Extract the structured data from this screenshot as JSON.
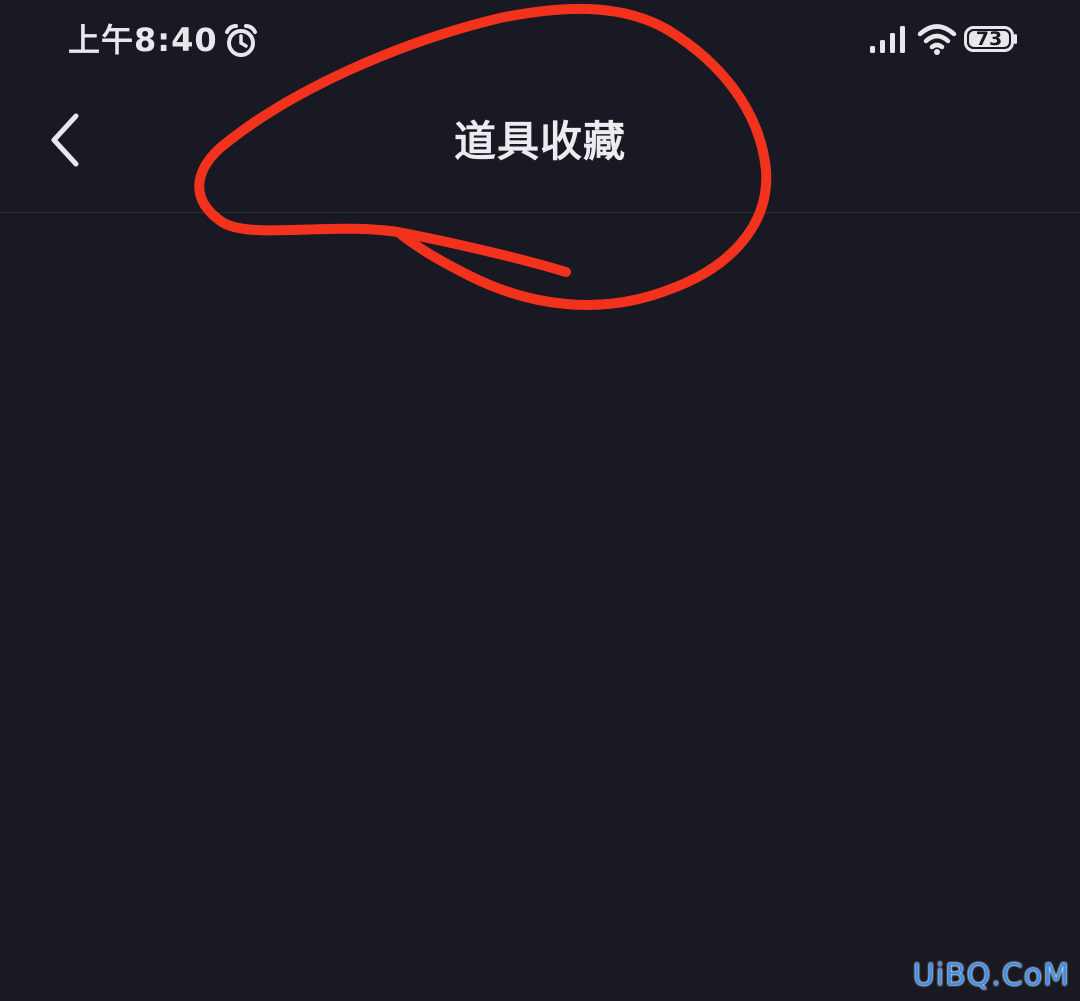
{
  "status_bar": {
    "time": "上午8:40",
    "battery_level": "73",
    "icons": [
      "alarm-icon",
      "signal-icon",
      "wifi-icon",
      "battery-icon"
    ]
  },
  "nav": {
    "title": "道具收藏",
    "back_icon": "chevron-left-icon"
  },
  "annotation": {
    "type": "red-freehand-circle",
    "color": "#f2321c"
  },
  "watermark": {
    "text": "UiBQ.CoM"
  },
  "colors": {
    "background": "#181922",
    "text": "#ececf0",
    "divider": "#2c2d36"
  }
}
